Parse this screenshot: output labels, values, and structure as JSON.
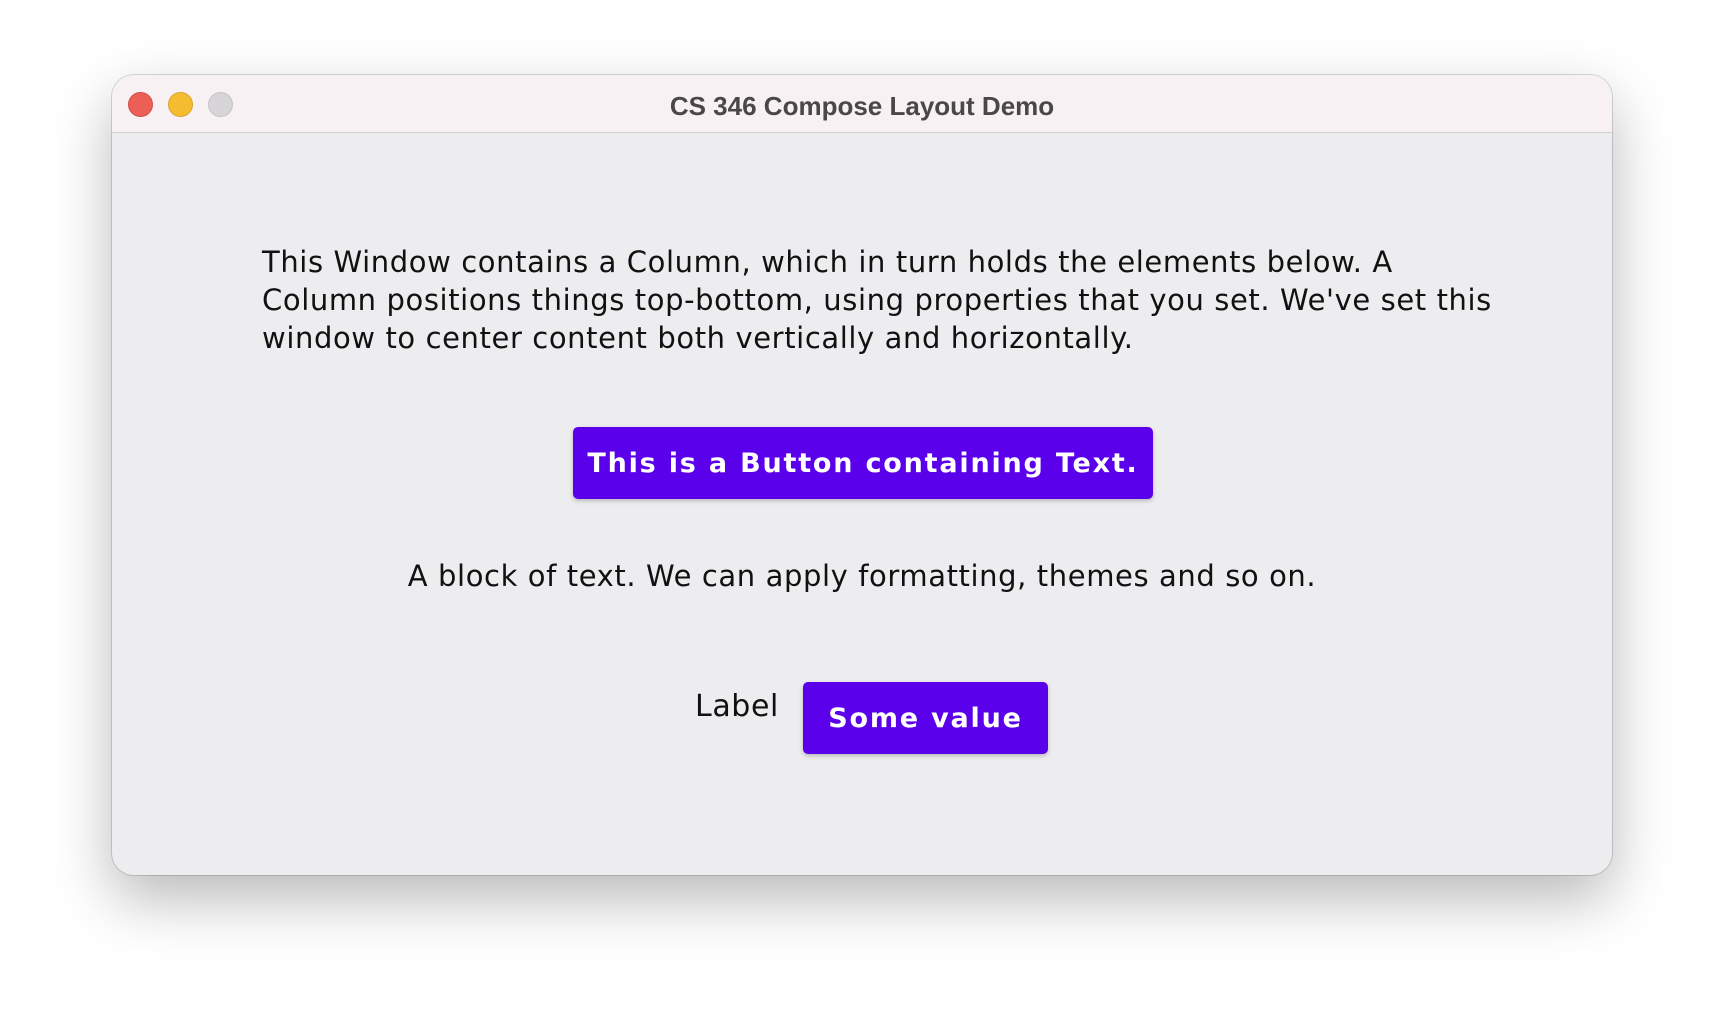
{
  "window": {
    "title": "CS 346 Compose Layout Demo"
  },
  "content": {
    "paragraph": "This Window contains a Column, which in turn holds the elements below. A Column positions things top-bottom, using properties that you set. We've set this window to center content both vertically and horizontally.",
    "button_label": "This is a Button containing Text.",
    "block_text": "A block of text. We can apply formatting, themes and so on.",
    "row": {
      "label": "Label",
      "value_button": "Some value"
    }
  },
  "colors": {
    "accent": "#5a00ea",
    "window_background": "#edecee",
    "titlebar_background": "#f8f1f4"
  }
}
